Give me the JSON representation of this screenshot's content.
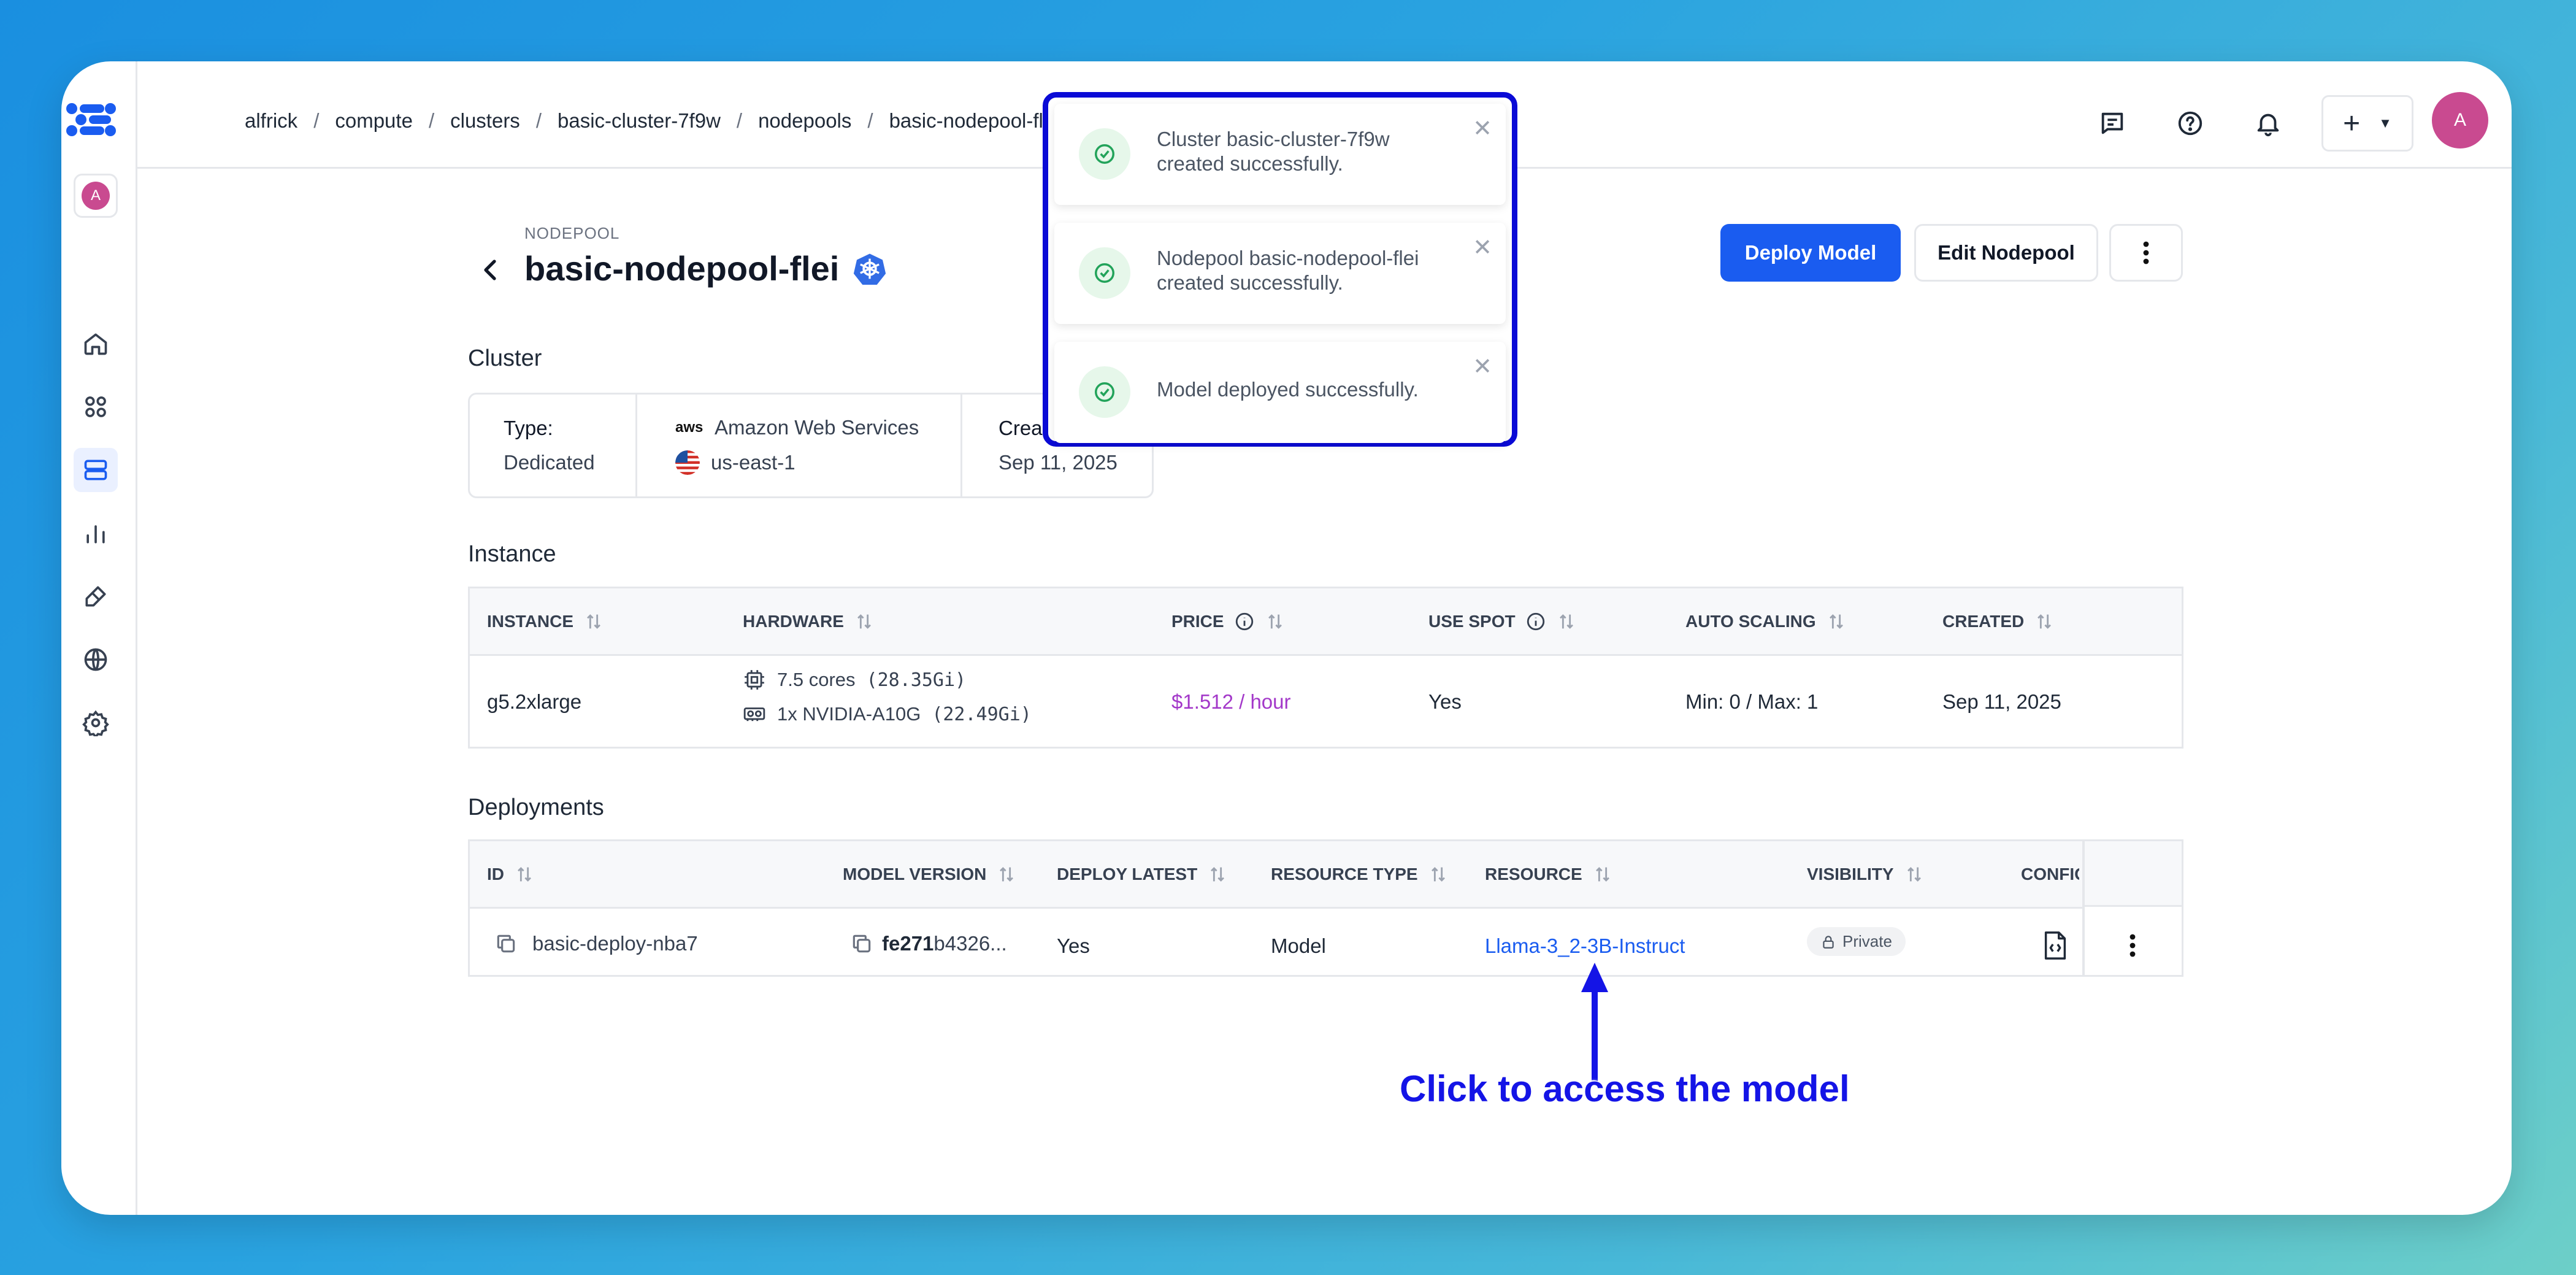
{
  "breadcrumbs": [
    "alfrick",
    "compute",
    "clusters",
    "basic-cluster-7f9w",
    "nodepools",
    "basic-nodepool-flei"
  ],
  "rail": {
    "workspace_initial": "A"
  },
  "topbar": {
    "user_initial": "A",
    "add_label": "+"
  },
  "header": {
    "eyebrow": "NODEPOOL",
    "title": "basic-nodepool-flei",
    "deploy_button": "Deploy Model",
    "edit_button": "Edit Nodepool"
  },
  "cluster": {
    "section_title": "Cluster",
    "type_label": "Type:",
    "type_value": "Dedicated",
    "provider_logo": "aws",
    "provider": "Amazon Web Services",
    "region": "us-east-1",
    "created_label": "Creat",
    "created_value": "Sep 11, 2025"
  },
  "instance": {
    "section_title": "Instance",
    "columns": [
      "INSTANCE",
      "HARDWARE",
      "PRICE",
      "USE SPOT",
      "AUTO SCALING",
      "CREATED"
    ],
    "row": {
      "instance": "g5.2xlarge",
      "cpu": "7.5 cores",
      "cpu_mem": "(28.35Gi)",
      "gpu": "1x NVIDIA-A10G",
      "gpu_mem": "(22.49Gi)",
      "price": "$1.512 / hour",
      "use_spot": "Yes",
      "auto_scaling": "Min: 0 / Max: 1",
      "created": "Sep 11, 2025"
    }
  },
  "deployments": {
    "section_title": "Deployments",
    "columns": [
      "ID",
      "MODEL VERSION",
      "DEPLOY LATEST",
      "RESOURCE TYPE",
      "RESOURCE",
      "VISIBILITY",
      "CONFIG"
    ],
    "row": {
      "id": "basic-deploy-nba7",
      "model_version_bold": "fe271",
      "model_version_rest": "b4326...",
      "deploy_latest": "Yes",
      "resource_type": "Model",
      "resource": "Llama-3_2-3B-Instruct",
      "visibility": "Private"
    }
  },
  "toasts": [
    {
      "message": "Cluster basic-cluster-7f9w created successfully."
    },
    {
      "message": "Nodepool basic-nodepool-flei created successfully."
    },
    {
      "message": "Model deployed successfully."
    }
  ],
  "annotation": "Click to access the model",
  "colors": {
    "primary": "#1a5cf0",
    "annotation": "#1414e6",
    "success": "#22a35a",
    "price": "#a338c9",
    "avatar": "#c94a90"
  }
}
